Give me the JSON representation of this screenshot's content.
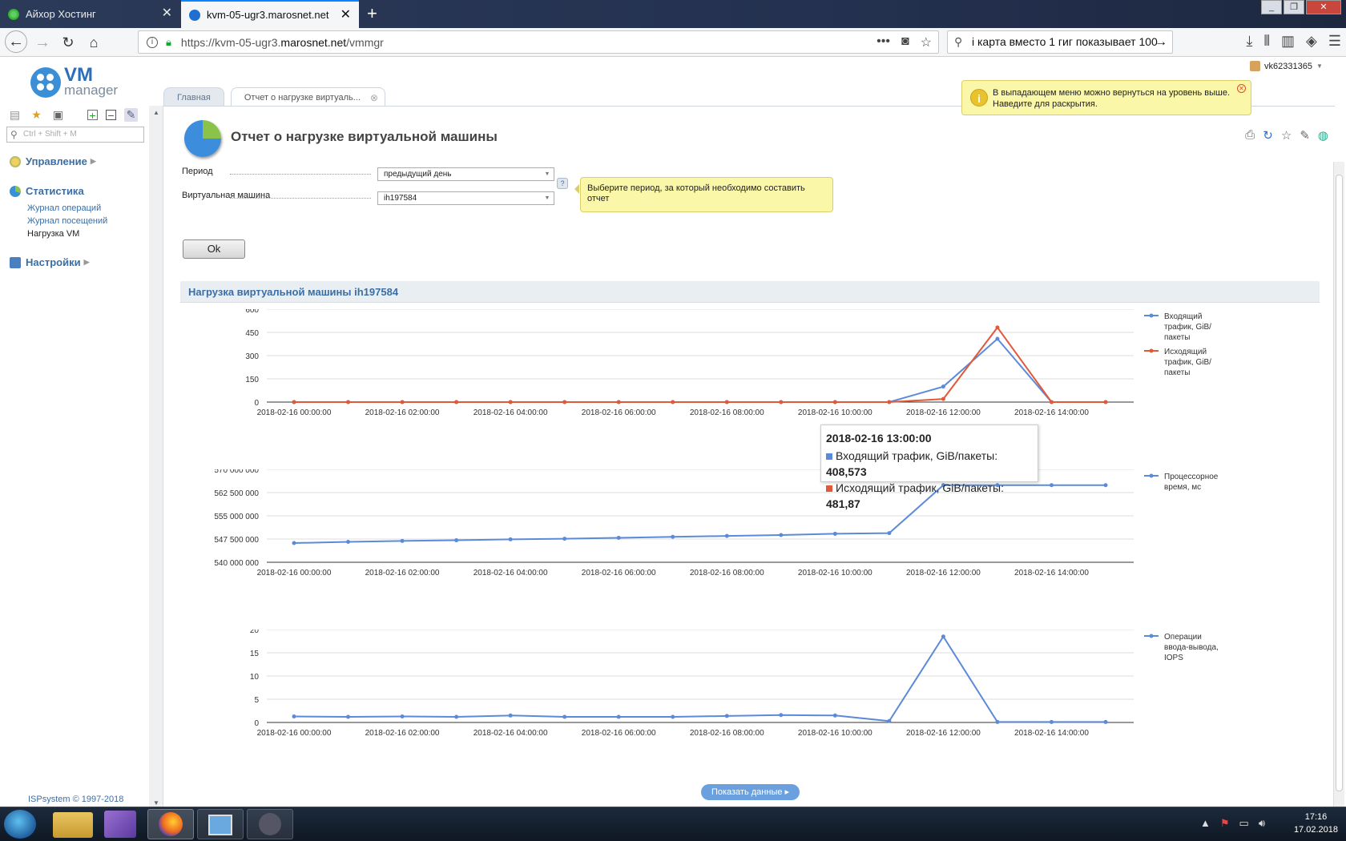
{
  "browser": {
    "tabs": [
      {
        "title": "Айхор Хостинг"
      },
      {
        "title": "kvm-05-ugr3.marosnet.net"
      }
    ],
    "url_prefix": "https://kvm-05-ugr3.",
    "url_domain": "marosnet.net",
    "url_path": "/vmmgr",
    "search_text": "і карта вместо 1 гиг показывает 100"
  },
  "app": {
    "logo_vm": "VM",
    "logo_manager": "manager",
    "user": "vk62331365",
    "sidebar_search_placeholder": "Ctrl + Shift + M",
    "menu": [
      {
        "label": "Управление",
        "icon_color": "#e0b030",
        "items": []
      },
      {
        "label": "Статистика",
        "icon_color": "#3a8fd6",
        "items": [
          {
            "label": "Журнал операций"
          },
          {
            "label": "Журнал посещений"
          },
          {
            "label": "Нагрузка VM"
          }
        ]
      },
      {
        "label": "Настройки",
        "icon_color": "#4a7fc0",
        "items": []
      }
    ],
    "copyright": "ISPsystem © 1997-2018",
    "notice": "В выпадающем меню можно вернуться на уровень выше. Наведите для раскрытия.",
    "tabs": [
      {
        "label": "Главная"
      },
      {
        "label": "Отчет о нагрузке виртуаль..."
      }
    ]
  },
  "form": {
    "title": "Отчет о нагрузке виртуальной машины",
    "period_label": "Период",
    "period_value": "предыдущий день",
    "vm_label": "Виртуальная машина",
    "vm_value": "ih197584",
    "help_mark": "?",
    "period_hint": "Выберите период, за который необходимо составить отчет",
    "ok_label": "Ok"
  },
  "report": {
    "section_title": "Нагрузка виртуальной машины ih197584",
    "show_data_label": "Показать данные",
    "tooltip": {
      "title": "2018-02-16 13:00:00",
      "rows": [
        {
          "label": "Входящий трафик, GiB/пакеты:",
          "value": "408,573",
          "color": "#5b8bd8"
        },
        {
          "label": "Исходящий трафик, GiB/пакеты:",
          "value": "481,87",
          "color": "#e05a3a"
        }
      ]
    }
  },
  "chart_data": [
    {
      "type": "line",
      "x": [
        "2018-02-16 00:00:00",
        "2018-02-16 01:00:00",
        "2018-02-16 02:00:00",
        "2018-02-16 03:00:00",
        "2018-02-16 04:00:00",
        "2018-02-16 05:00:00",
        "2018-02-16 06:00:00",
        "2018-02-16 07:00:00",
        "2018-02-16 08:00:00",
        "2018-02-16 09:00:00",
        "2018-02-16 10:00:00",
        "2018-02-16 11:00:00",
        "2018-02-16 12:00:00",
        "2018-02-16 13:00:00",
        "2018-02-16 14:00:00",
        "2018-02-16 15:00:00"
      ],
      "xticks": [
        "2018-02-16 00:00:00",
        "2018-02-16 02:00:00",
        "2018-02-16 04:00:00",
        "2018-02-16 06:00:00",
        "2018-02-16 08:00:00",
        "2018-02-16 10:00:00",
        "2018-02-16 12:00:00",
        "2018-02-16 14:00:00"
      ],
      "yticks": [
        "0",
        "150",
        "300",
        "450",
        "600"
      ],
      "ylim": [
        0,
        600
      ],
      "series": [
        {
          "name": "Входящий трафик, GiB/пакеты",
          "color": "#5b8bd8",
          "values": [
            0,
            0,
            0,
            0,
            0,
            0,
            0,
            0,
            0,
            0,
            0,
            0,
            100,
            408.573,
            0,
            0
          ]
        },
        {
          "name": "Исходящий трафик, GiB/пакеты",
          "color": "#e05a3a",
          "values": [
            0,
            0,
            0,
            0,
            0,
            0,
            0,
            0,
            0,
            0,
            0,
            0,
            20,
            481.87,
            0,
            0
          ]
        }
      ],
      "legend": [
        "Входящий",
        "трафик, GiB/",
        "пакеты"
      ],
      "legend2": [
        "Исходящий",
        "трафик, GiB/",
        "пакеты"
      ],
      "grid": true,
      "legend_position": "right"
    },
    {
      "type": "line",
      "x": [
        "2018-02-16 00:00:00",
        "2018-02-16 01:00:00",
        "2018-02-16 02:00:00",
        "2018-02-16 03:00:00",
        "2018-02-16 04:00:00",
        "2018-02-16 05:00:00",
        "2018-02-16 06:00:00",
        "2018-02-16 07:00:00",
        "2018-02-16 08:00:00",
        "2018-02-16 09:00:00",
        "2018-02-16 10:00:00",
        "2018-02-16 11:00:00",
        "2018-02-16 12:00:00",
        "2018-02-16 13:00:00",
        "2018-02-16 14:00:00",
        "2018-02-16 15:00:00"
      ],
      "xticks": [
        "2018-02-16 00:00:00",
        "2018-02-16 02:00:00",
        "2018-02-16 04:00:00",
        "2018-02-16 06:00:00",
        "2018-02-16 08:00:00",
        "2018-02-16 10:00:00",
        "2018-02-16 12:00:00",
        "2018-02-16 14:00:00"
      ],
      "yticks": [
        "540 000 000",
        "547 500 000",
        "555 000 000",
        "562 500 000",
        "570 000 000"
      ],
      "ylim": [
        540000000,
        570000000
      ],
      "series": [
        {
          "name": "Процессорное время, мс",
          "color": "#5b8bd8",
          "values": [
            546200000,
            546600000,
            546900000,
            547100000,
            547400000,
            547600000,
            547900000,
            548200000,
            548500000,
            548800000,
            549200000,
            549400000,
            564900000,
            564900000,
            564900000,
            564900000
          ]
        }
      ],
      "legend": [
        "Процессорное",
        "время, мс"
      ],
      "grid": true,
      "legend_position": "right"
    },
    {
      "type": "line",
      "x": [
        "2018-02-16 00:00:00",
        "2018-02-16 01:00:00",
        "2018-02-16 02:00:00",
        "2018-02-16 03:00:00",
        "2018-02-16 04:00:00",
        "2018-02-16 05:00:00",
        "2018-02-16 06:00:00",
        "2018-02-16 07:00:00",
        "2018-02-16 08:00:00",
        "2018-02-16 09:00:00",
        "2018-02-16 10:00:00",
        "2018-02-16 11:00:00",
        "2018-02-16 12:00:00",
        "2018-02-16 13:00:00",
        "2018-02-16 14:00:00",
        "2018-02-16 15:00:00"
      ],
      "xticks": [
        "2018-02-16 00:00:00",
        "2018-02-16 02:00:00",
        "2018-02-16 04:00:00",
        "2018-02-16 06:00:00",
        "2018-02-16 08:00:00",
        "2018-02-16 10:00:00",
        "2018-02-16 12:00:00",
        "2018-02-16 14:00:00"
      ],
      "yticks": [
        "0",
        "5",
        "10",
        "15",
        "20"
      ],
      "ylim": [
        0,
        20
      ],
      "series": [
        {
          "name": "Операции ввода-вывода, IOPS",
          "color": "#5b8bd8",
          "values": [
            1.3,
            1.2,
            1.3,
            1.2,
            1.5,
            1.2,
            1.2,
            1.2,
            1.4,
            1.6,
            1.5,
            0.3,
            18.5,
            0.1,
            0.1,
            0.1
          ]
        }
      ],
      "legend": [
        "Операции",
        "ввода-вывода,",
        "IOPS"
      ],
      "grid": true,
      "legend_position": "right"
    }
  ],
  "taskbar": {
    "time": "17:16",
    "date": "17.02.2018"
  }
}
